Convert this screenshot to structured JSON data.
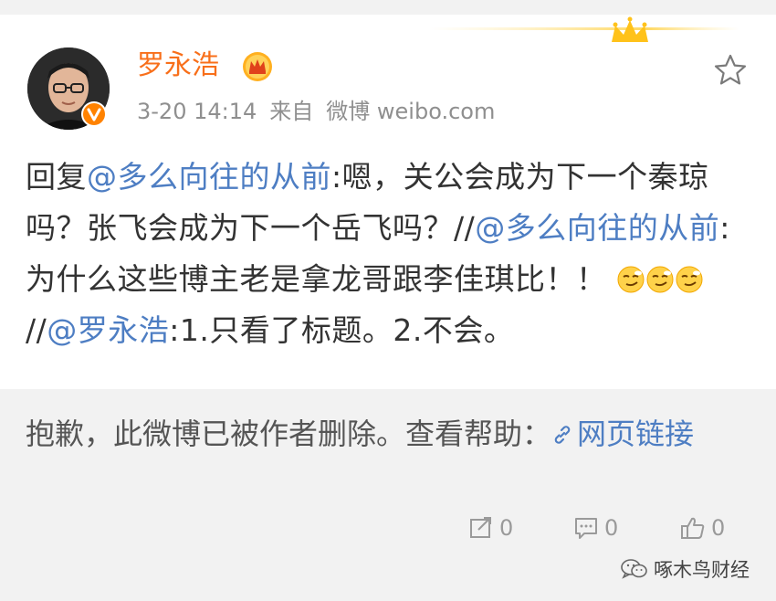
{
  "post": {
    "author_name": "罗永浩",
    "date": "3-20 14:14",
    "source_prefix": "来自",
    "source": "微博 weibo.com",
    "content": {
      "line1_prefix": "回复",
      "line1_mention": "@多么向往的从前",
      "line1_text": ":嗯，关公会成为下一个秦琼吗？张飞会成为下一个岳飞吗？//",
      "line2_mention": "@多么向往的从前",
      "line2_text": ":为什么这些博主老是拿龙哥跟李佳琪比！！",
      "emoji_name": "smirk-emoji",
      "emoji_count": 3,
      "line3_sep": "//",
      "line3_mention": "@罗永浩",
      "line3_text": ":1.只看了标题。2.不会。"
    }
  },
  "deleted_notice": {
    "text": "抱歉，此微博已被作者删除。查看帮助：",
    "link_label": "网页链接"
  },
  "actions": {
    "repost_count": "0",
    "comment_count": "0",
    "like_count": "0"
  },
  "watermark": {
    "text": "啄木鸟财经"
  },
  "colors": {
    "name": "#f86f1a",
    "mention": "#4e7ec3",
    "badge": "#ff8200",
    "meta": "#8f8f8f",
    "deleted_bg": "#f2f2f2"
  }
}
